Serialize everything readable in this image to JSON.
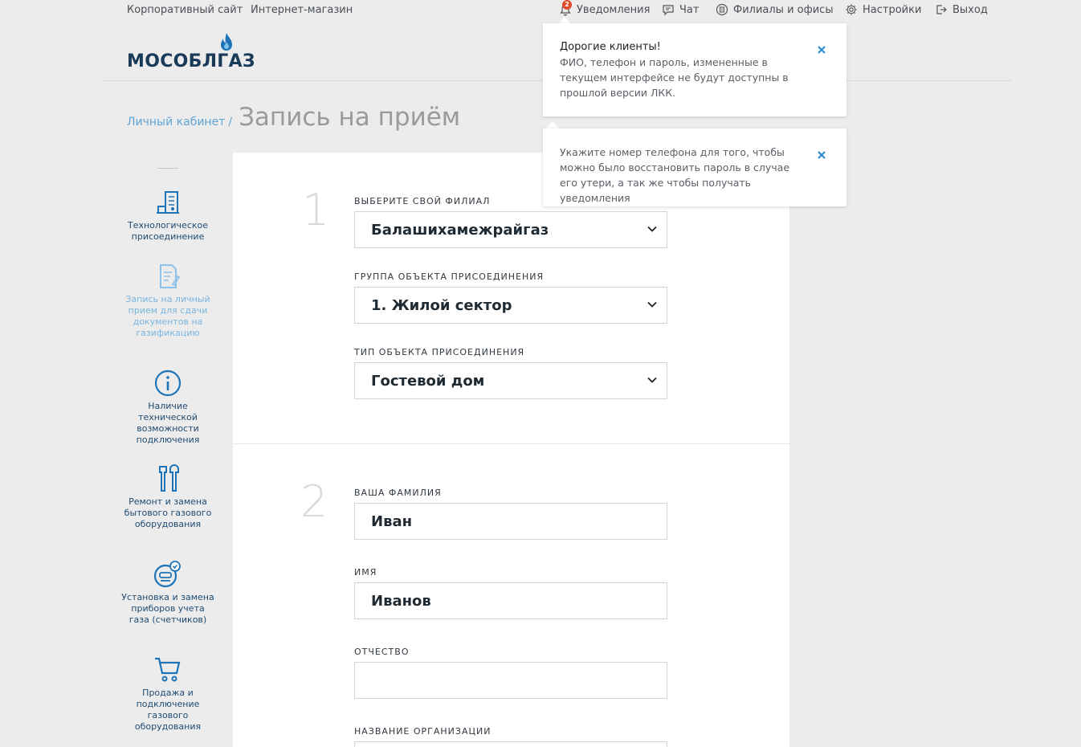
{
  "topbar": {
    "links": [
      "Корпоративный сайт",
      "Интернет-магазин"
    ],
    "notifications": {
      "label": "Уведомления",
      "count": "2"
    },
    "chat": "Чат",
    "branches": "Филиалы и офисы",
    "settings": "Настройки",
    "logout": "Выход"
  },
  "logo": {
    "text": "МОСОБЛГАЗ"
  },
  "breadcrumb": {
    "link": "Личный кабинет",
    "separator": "/",
    "title": "Запись на приём"
  },
  "sidebar": {
    "items": [
      {
        "label": "Технологическое присоединение",
        "icon": "building-icon"
      },
      {
        "label": "Запись на личный прием для сдачи документов на газификацию",
        "icon": "document-pen-icon"
      },
      {
        "label": "Наличие технической возможности подключения",
        "icon": "info-icon"
      },
      {
        "label": "Ремонт и замена бытового газового оборудования",
        "icon": "wrench-icon"
      },
      {
        "label": "Установка и замена приборов учета газа (счетчиков)",
        "icon": "meter-icon"
      },
      {
        "label": "Продажа и подключение газового оборудования",
        "icon": "cart-icon"
      }
    ]
  },
  "form": {
    "step1": {
      "number": "1",
      "branch_label": "ВЫБЕРИТЕ СВОЙ ФИЛИАЛ",
      "branch_value": "Балашихамежрайгаз",
      "group_label": "ГРУППА ОБЪЕКТА ПРИСОЕДИНЕНИЯ",
      "group_value": "1. Жилой сектор",
      "type_label": "ТИП ОБЪЕКТА ПРИСОЕДИНЕНИЯ",
      "type_value": "Гостевой дом"
    },
    "step2": {
      "number": "2",
      "surname_label": "ВАША ФАМИЛИЯ",
      "surname_value": "Иван",
      "name_label": "ИМЯ",
      "name_value": "Иванов",
      "patronymic_label": "ОТЧЕСТВО",
      "patronymic_value": "",
      "org_label": "НАЗВАНИЕ ОРГАНИЗАЦИИ"
    }
  },
  "popups": [
    {
      "title": "Дорогие клиенты!",
      "text": "ФИО, телефон и пароль, измененные в текущем интерфейсе не будут доступны в прошлой версии ЛКК."
    },
    {
      "title": "",
      "text": "Укажите номер телефона для того, чтобы можно было восстановить пароль в случае его утери, а так же чтобы получать уведомления"
    }
  ],
  "colors": {
    "brand": "#1a3a5a",
    "accent": "#5fa4d6",
    "close": "#2a8fd0",
    "badge": "#e24a2e"
  }
}
